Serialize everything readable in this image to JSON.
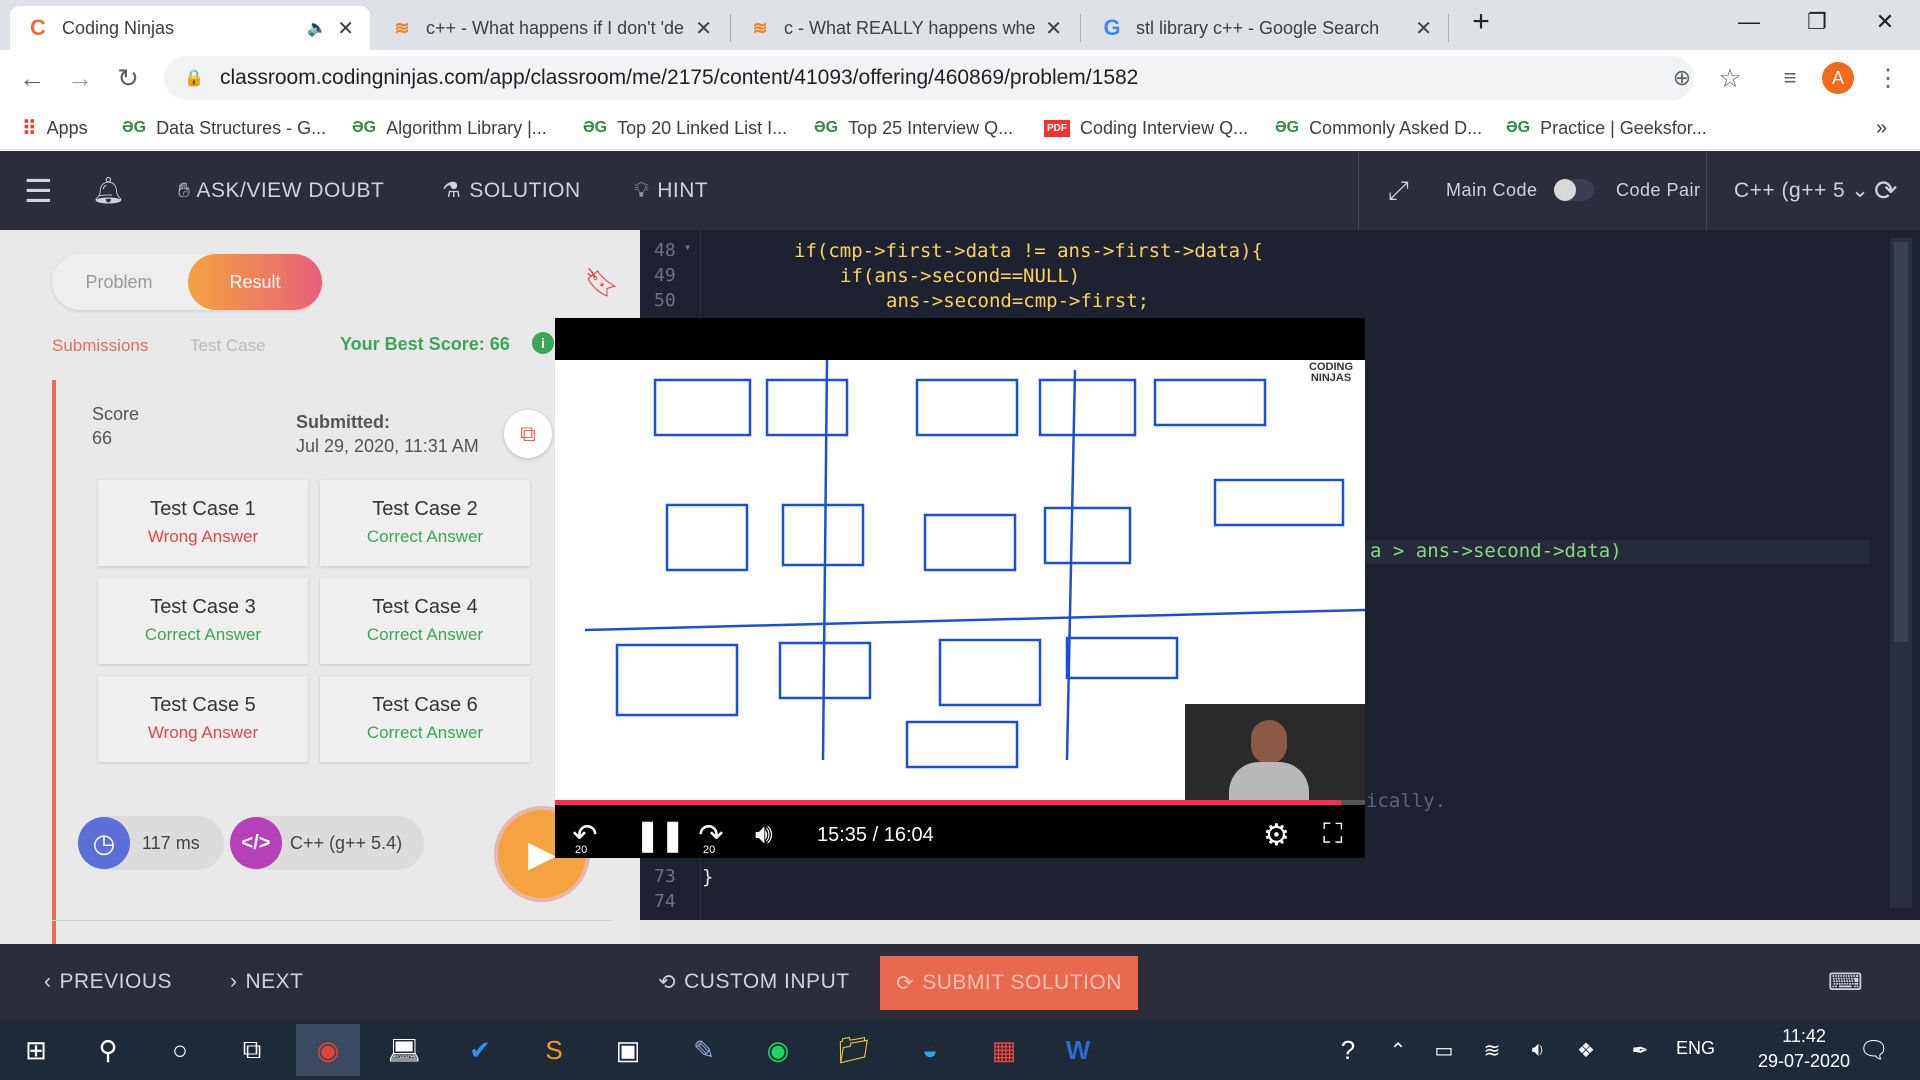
{
  "browser": {
    "tabs": [
      {
        "title": "Coding Ninjas",
        "favicon": "codingninjas-icon",
        "active": true
      },
      {
        "title": "c++ - What happens if I don't 'de",
        "favicon": "stackoverflow-icon"
      },
      {
        "title": "c - What REALLY happens when y",
        "favicon": "stackoverflow-icon"
      },
      {
        "title": "stl library c++ - Google Search",
        "favicon": "google-icon"
      }
    ],
    "url": "classroom.codingninjas.com/app/classroom/me/2175/content/41093/offering/460869/problem/1582",
    "profile_initial": "A",
    "bookmarks": [
      {
        "label": "Apps",
        "icon": "apps-icon"
      },
      {
        "label": "Data Structures - G...",
        "icon": "gfg-icon"
      },
      {
        "label": "Algorithm Library |...",
        "icon": "gfg-icon"
      },
      {
        "label": "Top 20 Linked List I...",
        "icon": "gfg-icon"
      },
      {
        "label": "Top 25 Interview Q...",
        "icon": "gfg-icon"
      },
      {
        "label": "Coding Interview Q...",
        "icon": "pdf-icon"
      },
      {
        "label": "Commonly Asked D...",
        "icon": "gfg-icon"
      },
      {
        "label": "Practice | Geeksfor...",
        "icon": "gfg-icon"
      }
    ],
    "more_bookmarks": "»"
  },
  "header": {
    "ask_doubt": "ASK/VIEW DOUBT",
    "solution": "SOLUTION",
    "hint": "HINT",
    "main_code": "Main Code",
    "code_pair": "Code Pair",
    "language": "C++ (g++ 5"
  },
  "left": {
    "tab_problem": "Problem",
    "tab_result": "Result",
    "submissions": "Submissions",
    "test_case": "Test Case",
    "best_score": "Your Best Score: 66",
    "score_label": "Score",
    "score_value": "66",
    "submitted_label": "Submitted:",
    "submitted_value": "Jul 29, 2020, 11:31 AM",
    "test_cases": [
      {
        "name": "Test Case 1",
        "status": "Wrong Answer",
        "ok": false
      },
      {
        "name": "Test Case 2",
        "status": "Correct Answer",
        "ok": true
      },
      {
        "name": "Test Case 3",
        "status": "Correct Answer",
        "ok": true
      },
      {
        "name": "Test Case 4",
        "status": "Correct Answer",
        "ok": true
      },
      {
        "name": "Test Case 5",
        "status": "Wrong Answer",
        "ok": false
      },
      {
        "name": "Test Case 6",
        "status": "Correct Answer",
        "ok": true
      }
    ],
    "runtime": "117 ms",
    "lang_used": "C++ (g++ 5.4)"
  },
  "editor": {
    "line_numbers": [
      "48",
      "49",
      "50",
      "73",
      "74"
    ],
    "lines": {
      "l48": "if(cmp->first->data != ans->first->data){",
      "l49": "if(ans->second==NULL)",
      "l50": "ans->second=cmp->first;",
      "l73": "}",
      "l74": ""
    },
    "partial_right_1": "a > ans->second->data)",
    "partial_right_2": "ically."
  },
  "video": {
    "time": "15:35 / 16:04",
    "skip_back": "20",
    "skip_fwd": "20",
    "progress": 0.97,
    "logo": "CODING NINJAS"
  },
  "bottom": {
    "previous": "PREVIOUS",
    "next": "NEXT",
    "custom_input": "CUSTOM INPUT",
    "submit": "SUBMIT SOLUTION"
  },
  "taskbar": {
    "lang": "ENG",
    "time": "11:42",
    "date": "29-07-2020"
  },
  "colors": {
    "accent_orange": "#f4a340",
    "result_gradient_end": "#e8607a",
    "wrong": "#e0474c",
    "correct": "#3aa757",
    "header_bg": "#2b2d3a",
    "submit_bg": "#e8694f"
  }
}
